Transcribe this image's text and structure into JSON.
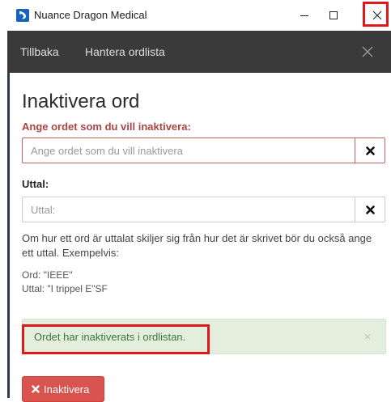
{
  "window": {
    "title": "Nuance Dragon Medical",
    "icons": {
      "logo": "dragon-logo-icon",
      "minimize": "minimize-icon",
      "maximize": "maximize-icon",
      "close": "close-icon"
    }
  },
  "nav": {
    "back_label": "Tillbaka",
    "manage_label": "Hantera ordlista",
    "close_icon": "close-icon"
  },
  "page": {
    "title": "Inaktivera ord"
  },
  "word_field": {
    "label": "Ange ordet som du vill inaktivera:",
    "value": "",
    "placeholder": "Ange ordet som du vill inaktivera",
    "clear_icon": "times-icon"
  },
  "pronunciation_field": {
    "label": "Uttal:",
    "value": "",
    "placeholder": "Uttal:",
    "clear_icon": "times-icon"
  },
  "help": {
    "text": "Om hur ett ord är uttalat skiljer sig från hur det är skrivet bör du också ange ett uttal. Exempelvis:",
    "example_word": "Ord: \"IEEE\"",
    "example_pron": "Uttal: \"I trippel E\"SF"
  },
  "alert": {
    "message": "Ordet har inaktiverats i ordlistan.",
    "close_glyph": "×"
  },
  "actions": {
    "inactivate_label": "Inaktivera",
    "inactivate_icon": "times-icon"
  },
  "colors": {
    "navbar": "#3a3a3a",
    "error_label": "#a94442",
    "alert_bg": "#e4eedd",
    "alert_text": "#3c763d",
    "danger_button": "#d9534f",
    "highlight": "#e0181c",
    "logo": "#1565c0"
  }
}
